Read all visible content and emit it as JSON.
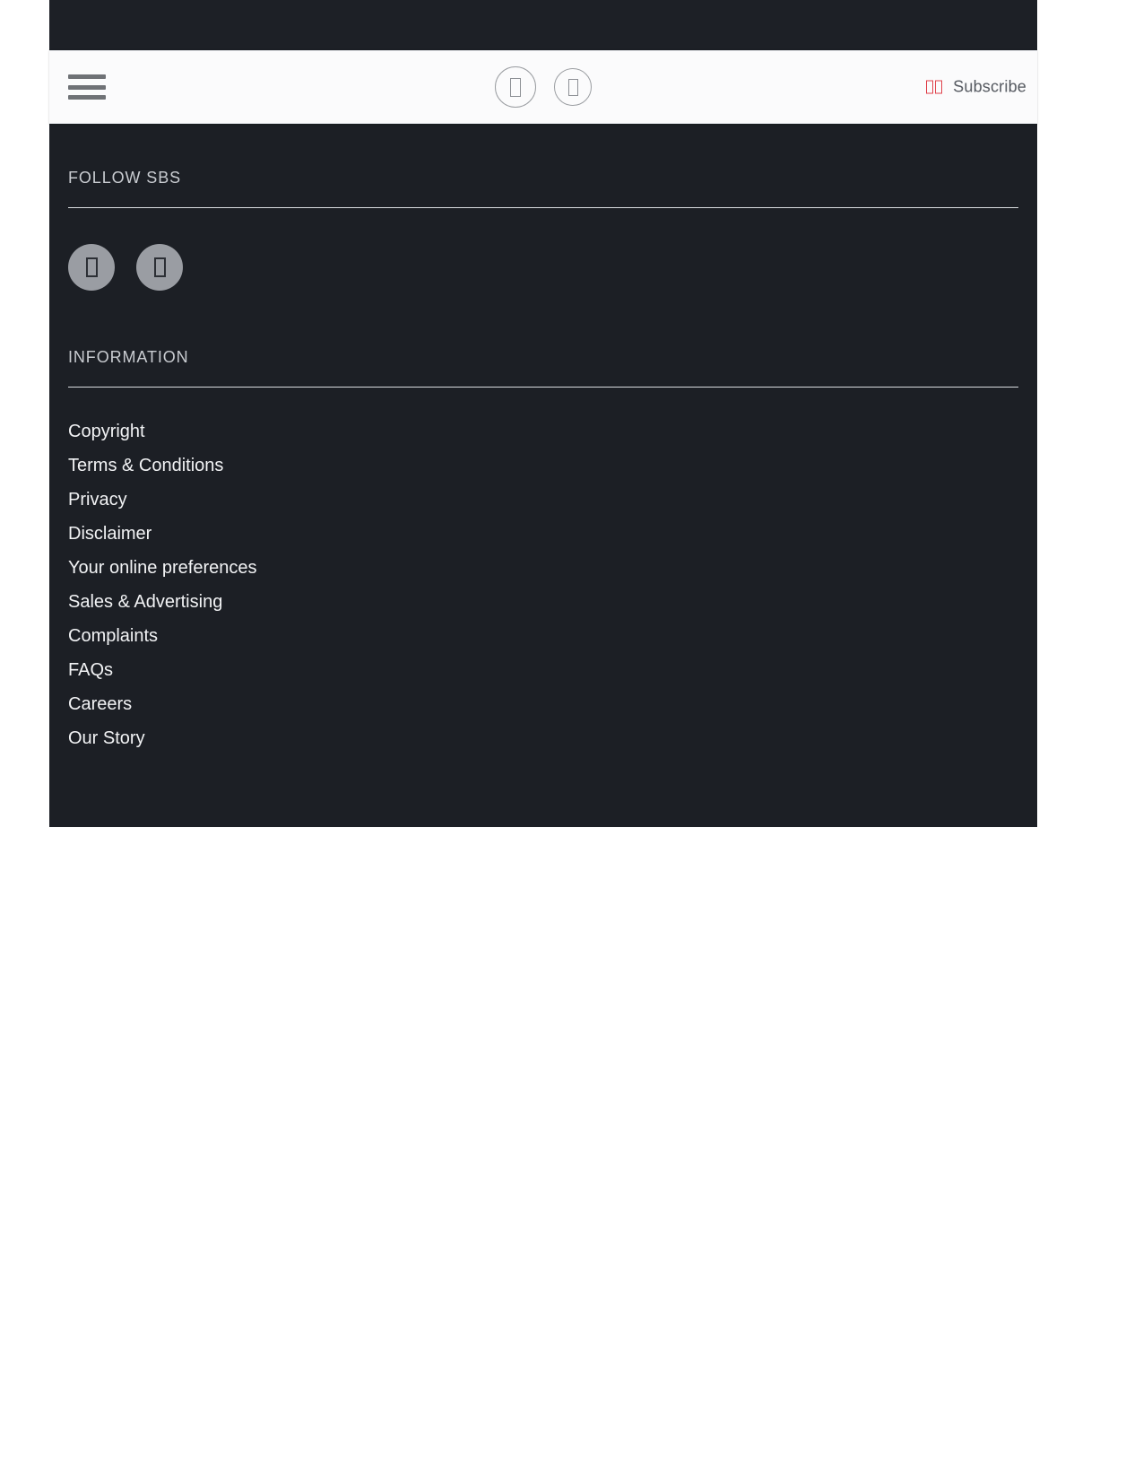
{
  "header": {
    "menu_button": "Menu",
    "center_buttons": [
      {
        "name": "header-icon-button-1",
        "glyph": "tofu"
      },
      {
        "name": "header-icon-button-2",
        "glyph": "tofu"
      }
    ],
    "subscribe": {
      "label": "Subscribe",
      "icon": "grid-icon",
      "icon_color": "#e0434d"
    }
  },
  "footer": {
    "follow": {
      "heading": "FOLLOW SBS",
      "social_buttons": [
        {
          "name": "social-button-1",
          "glyph": "tofu"
        },
        {
          "name": "social-button-2",
          "glyph": "tofu"
        }
      ]
    },
    "information": {
      "heading": "INFORMATION",
      "links": [
        {
          "label": "Copyright"
        },
        {
          "label": "Terms & Conditions"
        },
        {
          "label": "Privacy"
        },
        {
          "label": "Disclaimer"
        },
        {
          "label": "Your online preferences"
        },
        {
          "label": "Sales & Advertising"
        },
        {
          "label": "Complaints"
        },
        {
          "label": "FAQs"
        },
        {
          "label": "Careers"
        },
        {
          "label": "Our Story"
        }
      ]
    }
  },
  "colors": {
    "dark_bg": "#1c1f25",
    "header_bg": "#fbfbfc",
    "accent_red": "#e0434d",
    "link_text": "#f2f3f5"
  }
}
